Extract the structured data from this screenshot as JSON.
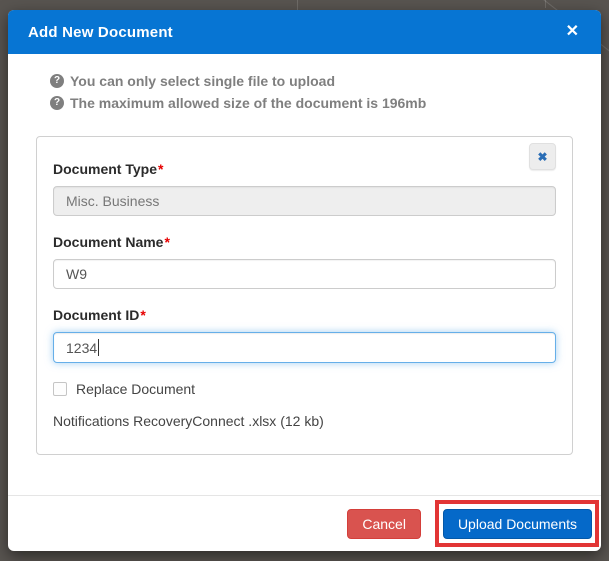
{
  "colors": {
    "header_blue": "#0775d3",
    "primary_button_blue": "#0569c9",
    "primary_button_border": "#0458a8",
    "cancel_red": "#d9534f",
    "cancel_red_border": "#d43f3a",
    "annotation_red": "#e23535",
    "focus_blue": "#66afe9"
  },
  "icons": {
    "question": "?",
    "close_x": "✕",
    "clear_x": "✖"
  },
  "modal": {
    "title": "Add New Document",
    "notes": [
      "You can only select single file to upload",
      "The maximum allowed size of the document is 196mb"
    ]
  },
  "form": {
    "required_mark": "*",
    "document_type": {
      "label": "Document Type",
      "value": "Misc. Business"
    },
    "document_name": {
      "label": "Document Name",
      "value": "W9"
    },
    "document_id": {
      "label": "Document ID",
      "value": "1234"
    },
    "replace_label": "Replace Document",
    "file_info": "Notifications RecoveryConnect .xlsx (12 kb)"
  },
  "footer": {
    "cancel_label": "Cancel",
    "upload_label": "Upload Documents"
  }
}
